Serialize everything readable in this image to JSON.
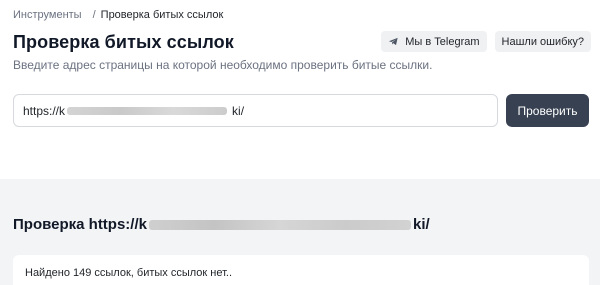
{
  "breadcrumb": {
    "root": "Инструменты",
    "separator": "/",
    "current": "Проверка битых ссылок"
  },
  "page": {
    "title": "Проверка битых ссылок",
    "subtitle": "Введите адрес страницы на которой необходимо проверить битые ссылки."
  },
  "actions": {
    "telegram_label": "Мы в Telegram",
    "telegram_icon": "telegram-plane-icon",
    "report_label": "Нашли ошибку?"
  },
  "form": {
    "url_prefix": "https://k",
    "url_suffix": "ki/",
    "submit_label": "Проверить"
  },
  "results": {
    "title_prefix": "Проверка https://k",
    "title_suffix": "ki/",
    "summary": "Найдено 149 ссылок, битых ссылок нет.."
  },
  "colors": {
    "button_bg": "#374151",
    "results_bg": "#f3f4f6",
    "chip_bg": "#f0f1f3"
  }
}
